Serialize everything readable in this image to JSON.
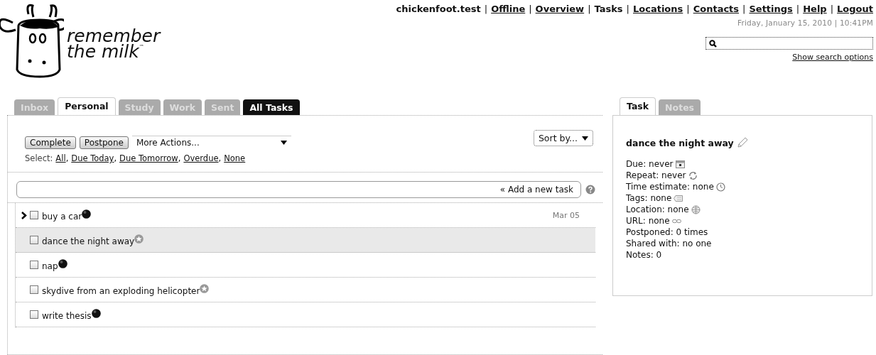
{
  "header": {
    "nav": [
      {
        "label": "chickenfoot.test",
        "link": false
      },
      {
        "label": "Offline",
        "link": true
      },
      {
        "label": "Overview",
        "link": true
      },
      {
        "label": "Tasks",
        "link": false
      },
      {
        "label": "Locations",
        "link": true
      },
      {
        "label": "Contacts",
        "link": true
      },
      {
        "label": "Settings",
        "link": true
      },
      {
        "label": "Help",
        "link": true
      },
      {
        "label": "Logout",
        "link": true
      }
    ],
    "separator": "|",
    "datetime": "Friday, January 15, 2010 | 10:41PM",
    "search_options": "Show search options"
  },
  "logo": {
    "line_1": "remember",
    "line_2": "the milk",
    "mark": "™"
  },
  "tabs": [
    {
      "label": "Inbox",
      "selected": false,
      "dark": false
    },
    {
      "label": "Personal",
      "selected": true,
      "dark": false
    },
    {
      "label": "Study",
      "selected": false,
      "dark": false
    },
    {
      "label": "Work",
      "selected": false,
      "dark": false
    },
    {
      "label": "Sent",
      "selected": false,
      "dark": false
    },
    {
      "label": "All Tasks",
      "selected": false,
      "dark": true
    }
  ],
  "actions": {
    "buttons": [
      "Complete",
      "Postpone"
    ],
    "more": "More Actions...",
    "sort": "Sort by...",
    "select_label": "Select:",
    "select_separator": ",",
    "select_links": [
      "All",
      "Due Today",
      "Due Tomorrow",
      "Overdue",
      "None"
    ]
  },
  "add_task": {
    "label": "« Add a new task"
  },
  "tasks": [
    {
      "name": "buy a car",
      "checked": false,
      "selected": false,
      "current": true,
      "kind": "dot",
      "due": "Mar 05"
    },
    {
      "name": "dance the night away",
      "checked": false,
      "selected": true,
      "current": false,
      "kind": "star"
    },
    {
      "name": "nap",
      "checked": false,
      "selected": false,
      "current": false,
      "kind": "dot"
    },
    {
      "name": "skydive from an exploding helicopter",
      "checked": false,
      "selected": false,
      "current": false,
      "kind": "star"
    },
    {
      "name": "write thesis",
      "checked": false,
      "selected": false,
      "current": false,
      "kind": "dot"
    }
  ],
  "detail_tabs": [
    {
      "label": "Task",
      "selected": true
    },
    {
      "label": "Notes",
      "selected": false
    }
  ],
  "detail": {
    "title": "dance the night away",
    "fields": [
      {
        "text": "Due: never",
        "kind": "calendar"
      },
      {
        "text": "Repeat: never",
        "kind": "repeat"
      },
      {
        "text": "Time estimate: none",
        "kind": "clock"
      },
      {
        "text": "Tags: none",
        "kind": "tag"
      },
      {
        "text": "Location: none",
        "kind": "globe"
      },
      {
        "text": "URL: none",
        "kind": "link"
      },
      {
        "text": "Postponed: 0 times",
        "kind": "plain"
      },
      {
        "text": "Shared with: no one",
        "kind": "plain"
      },
      {
        "text": "Notes: 0",
        "kind": "plain"
      }
    ]
  }
}
